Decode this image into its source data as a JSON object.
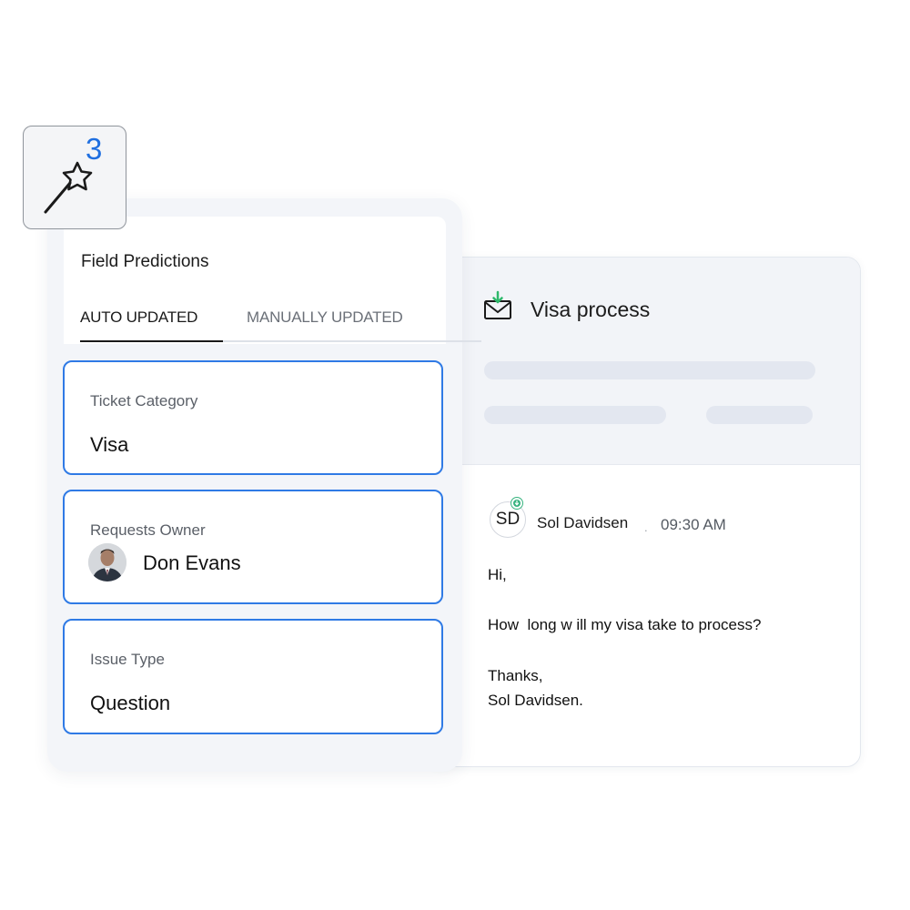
{
  "wand": {
    "count": "3",
    "icon": "magic-wand-icon"
  },
  "predictions": {
    "title": "Field Predictions",
    "tabs": [
      {
        "label": "AUTO UPDATED",
        "active": true
      },
      {
        "label": "MANUALLY UPDATED",
        "active": false
      }
    ],
    "fields": [
      {
        "label": "Ticket Category",
        "value": "Visa"
      },
      {
        "label": "Requests Owner",
        "value": "Don Evans",
        "avatar": "person-photo"
      },
      {
        "label": "Issue Type",
        "value": "Question"
      }
    ]
  },
  "email": {
    "subject": "Visa process",
    "icon": "envelope-download-icon",
    "sender": {
      "initials": "SD",
      "name": "Sol Davidsen",
      "separator": ".",
      "time": "09:30 AM"
    },
    "body": [
      "Hi,",
      "How  long w ill my visa take to process?",
      "Thanks,",
      "Sol Davidsen."
    ]
  },
  "colors": {
    "accent": "#2f7ae5",
    "count": "#1f6fe0",
    "success": "#36b37e",
    "panel_bg": "#f3f5f9",
    "skeleton": "#e3e7f0"
  }
}
